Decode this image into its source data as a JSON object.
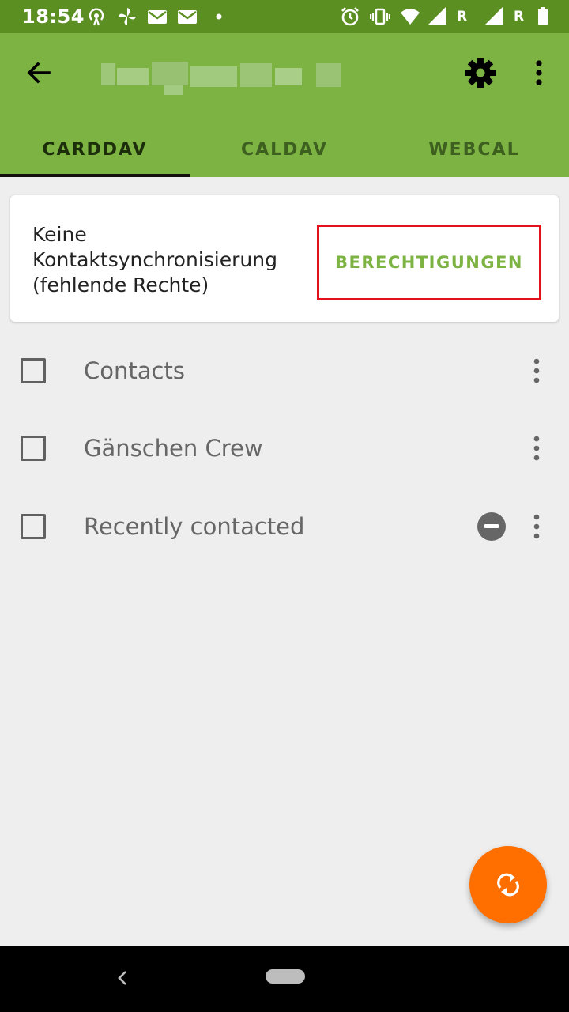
{
  "status_bar": {
    "time": "18:54",
    "background": "#5c8f22",
    "icons": [
      "hotspot-icon",
      "pinwheel-icon",
      "mail-icon",
      "mail-icon",
      "dot-icon",
      "alarm-icon",
      "vibrate-icon",
      "wifi-icon",
      "signal-icon",
      "signal-icon",
      "battery-icon"
    ],
    "roaming_label": "R"
  },
  "app_bar": {
    "background": "#7cb342",
    "title_obscured": true,
    "tabs": [
      {
        "label": "CARDDAV",
        "selected": true
      },
      {
        "label": "CALDAV",
        "selected": false
      },
      {
        "label": "WEBCAL",
        "selected": false
      }
    ]
  },
  "permission_card": {
    "message": "Keine Kontaktsynchronisierung (fehlende Rechte)",
    "button_label": "BERECHTIGUNGEN",
    "button_color": "#7cb342",
    "highlight_color": "#e3111b"
  },
  "address_books": [
    {
      "name": "Contacts",
      "checked": false,
      "read_only": false
    },
    {
      "name": "Gänschen Crew",
      "checked": false,
      "read_only": false
    },
    {
      "name": "Recently contacted",
      "checked": false,
      "read_only": true
    }
  ],
  "fab": {
    "icon": "sync-icon",
    "color": "#ff6f00"
  },
  "nav_bar": {
    "icons": [
      "nav-back-icon",
      "nav-home-pill"
    ]
  }
}
